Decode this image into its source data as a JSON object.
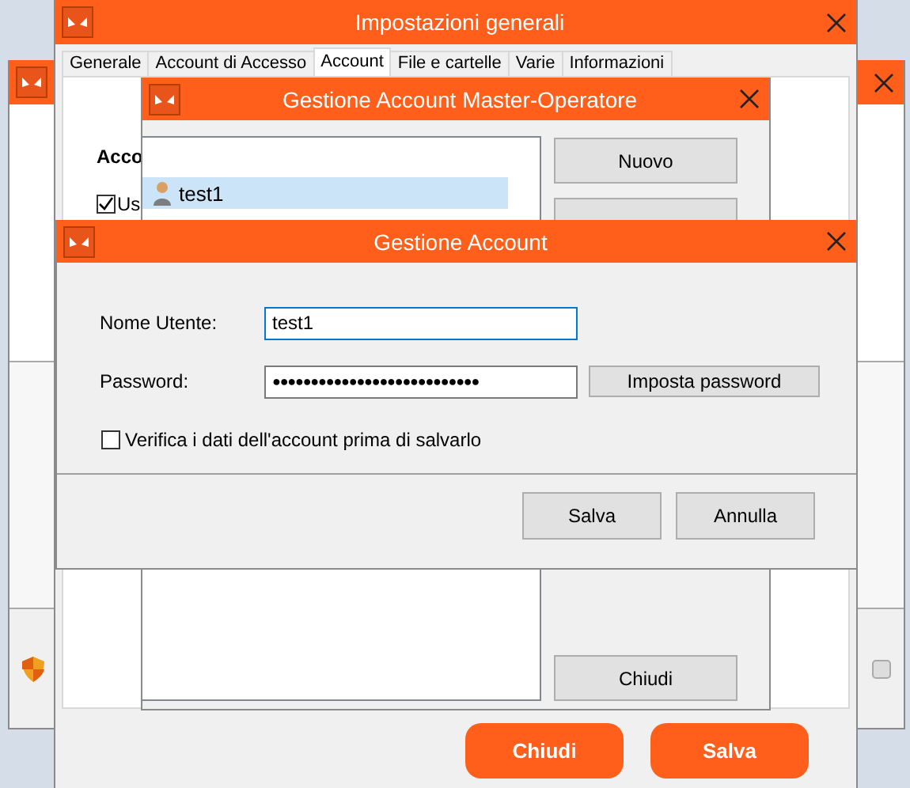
{
  "settings_window": {
    "title": "Impostazioni generali",
    "tabs": [
      {
        "label": "Generale",
        "selected": false
      },
      {
        "label": "Account di Accesso",
        "selected": false
      },
      {
        "label": "Account",
        "selected": true
      },
      {
        "label": "File e cartelle",
        "selected": false
      },
      {
        "label": "Varie",
        "selected": false
      },
      {
        "label": "Informazioni",
        "selected": false
      }
    ],
    "section_heading": "Acco",
    "option": {
      "label": "Us",
      "checked": true
    },
    "buttons": [
      {
        "label": "Chiudi"
      },
      {
        "label": "Salva"
      }
    ]
  },
  "master_window": {
    "title": "Gestione Account Master-Operatore",
    "accounts": [
      {
        "name": "test1",
        "selected": true
      }
    ],
    "buttons": [
      {
        "label": "Nuovo"
      },
      {
        "label": "Chiudi"
      }
    ]
  },
  "account_dialog": {
    "title": "Gestione Account",
    "fields": [
      {
        "label": "Nome Utente:",
        "value": "test1",
        "focused": true
      },
      {
        "label": "Password:",
        "value": "●●●●●●●●●●●●●●●●●●●●●●●●●●●",
        "focused": false
      }
    ],
    "set_password_button": "Imposta password",
    "verify": {
      "label": "Verifica i dati dell'account prima di salvarlo",
      "checked": false
    },
    "buttons": [
      {
        "label": "Salva"
      },
      {
        "label": "Annulla"
      }
    ]
  }
}
